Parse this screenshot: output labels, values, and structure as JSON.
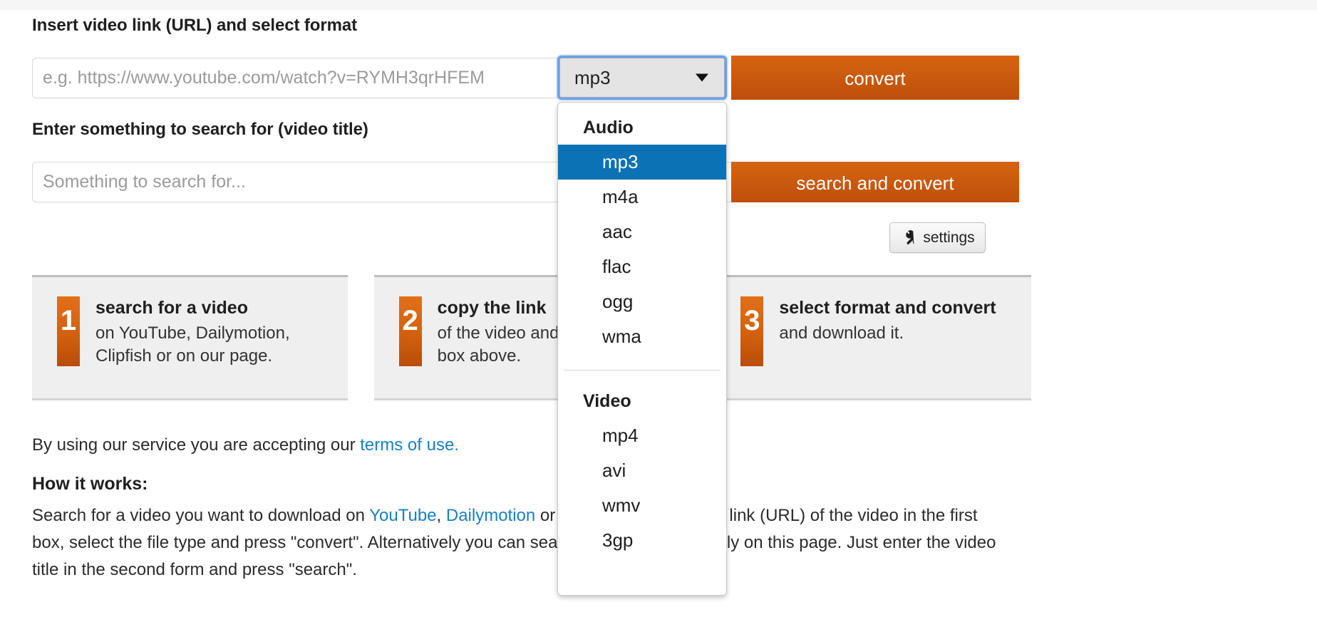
{
  "form": {
    "url_label": "Insert video link (URL) and select format",
    "url_placeholder": "e.g. https://www.youtube.com/watch?v=RYMH3qrHFEM",
    "url_value": "",
    "search_label": "Enter something to search for (video title)",
    "search_placeholder": "Something to search for...",
    "search_value": "",
    "convert_button": "convert",
    "search_convert_button": "search and convert",
    "settings_button": "settings",
    "settings_icon": "wrench-icon"
  },
  "format_select": {
    "selected_value": "mp3",
    "caret_icon": "chevron-down-icon",
    "groups": [
      {
        "label": "Audio",
        "options": [
          "mp3",
          "m4a",
          "aac",
          "flac",
          "ogg",
          "wma"
        ]
      },
      {
        "label": "Video",
        "options": [
          "mp4",
          "avi",
          "wmv",
          "3gp"
        ]
      }
    ]
  },
  "steps": [
    {
      "number": "1",
      "title": "search for a video",
      "desc": "on YouTube, Dailymotion, Clipfish or on our page."
    },
    {
      "number": "2",
      "title": "copy the link",
      "desc": "of the video and paste it in the box above."
    },
    {
      "number": "3",
      "title": "select format and convert",
      "desc": "and download it."
    }
  ],
  "terms": {
    "prefix": "By using our service you are accepting our ",
    "link": "terms of use."
  },
  "how_it_works": {
    "heading": "How it works:",
    "part1": "Search for a video you want to download on ",
    "link1": "YouTube",
    "sep1": ", ",
    "link2": "Dailymotion",
    "part2": " or Clipfish and paste the link (URL) of the video in the first box, select the file type and press \"convert\". Alternatively you can search for the video directly on this page. Just enter the video title in the second form and press \"search\"."
  },
  "colors": {
    "accent_orange": "#c8570e",
    "link_blue": "#1a7fc4",
    "highlight_blue": "#0a72b5",
    "focus_ring": "#6aa0f0"
  }
}
